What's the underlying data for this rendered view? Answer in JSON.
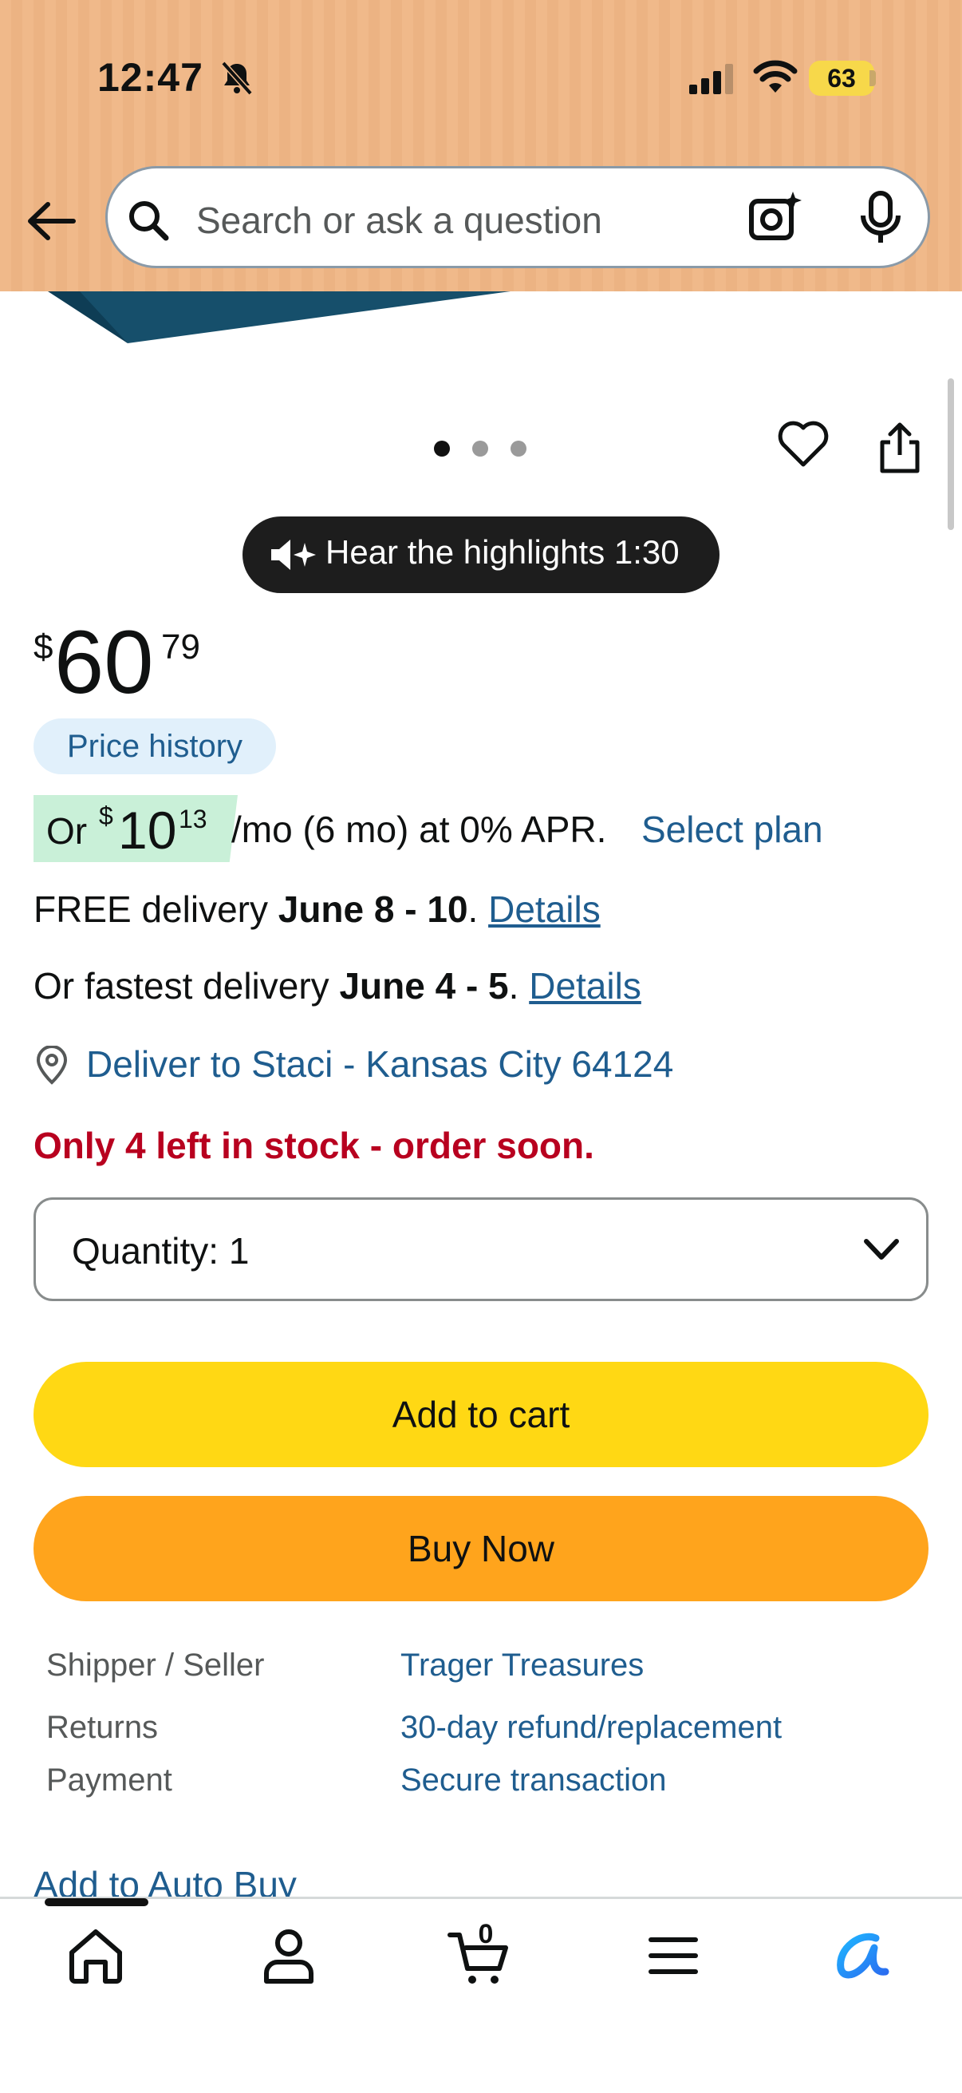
{
  "status_bar": {
    "time": "12:47",
    "battery": "63"
  },
  "search": {
    "placeholder": "Search or ask a question"
  },
  "audio": {
    "label": "Hear the highlights 1:30"
  },
  "price": {
    "symbol": "$",
    "whole": "60",
    "fraction": "79"
  },
  "price_history": {
    "label": "Price history"
  },
  "monthly": {
    "prefix": "Or",
    "symbol": "$",
    "whole": "10",
    "cents": "13",
    "terms": "/mo (6 mo) at 0% APR.",
    "select_plan": "Select plan"
  },
  "delivery": {
    "free_prefix": "FREE delivery ",
    "free_dates": "June 8 - 10",
    "free_period": ".",
    "fastest_prefix": "Or fastest delivery ",
    "fastest_dates": "June 4 - 5",
    "fastest_period": ".",
    "details": "Details",
    "deliver_to": "Deliver to Staci - Kansas City 64124"
  },
  "stock": {
    "text": "Only 4 left in stock - order soon."
  },
  "quantity": {
    "label": "Quantity:",
    "value": "1"
  },
  "buttons": {
    "add_to_cart": "Add to cart",
    "buy_now": "Buy Now"
  },
  "info": [
    {
      "label": "Shipper / Seller",
      "value": "Trager Treasures"
    },
    {
      "label": "Returns",
      "value": "30-day refund/replacement"
    },
    {
      "label": "Payment",
      "value": "Secure transaction"
    }
  ],
  "auto_buy": {
    "label": "Add to Auto Buy"
  },
  "bottom_nav": {
    "cart_count": "0",
    "items": [
      "home-icon",
      "account-icon",
      "cart-icon",
      "menu-icon",
      "rufus-icon"
    ]
  },
  "colors": {
    "header": "#f0b98a",
    "link": "#1f5d8f",
    "add_to_cart": "#ffd814",
    "buy_now": "#ffa41c",
    "stock_warning": "#b8001f"
  }
}
